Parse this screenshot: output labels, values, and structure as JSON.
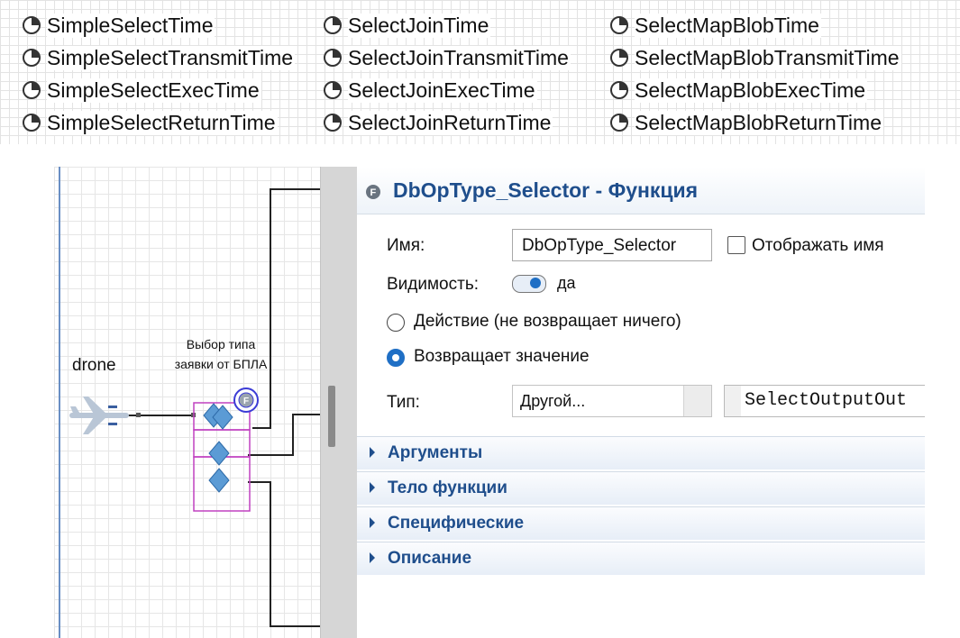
{
  "variables": {
    "col1": [
      "SimpleSelectTime",
      "SimpleSelectTransmitTime",
      "SimpleSelectExecTime",
      "SimpleSelectReturnTime"
    ],
    "col2": [
      "SelectJoinTime",
      "SelectJoinTransmitTime",
      "SelectJoinExecTime",
      "SelectJoinReturnTime"
    ],
    "col3": [
      "SelectMapBlobTime",
      "SelectMapBlobTransmitTime",
      "SelectMapBlobExecTime",
      "SelectMapBlobReturnTime"
    ],
    "icon": "statistics-gauge-icon"
  },
  "canvas": {
    "source_label": "drone",
    "block_label_line1": "Выбор типа",
    "block_label_line2": "заявки от БПЛА",
    "function_icon": "function-icon",
    "source_icon": "airplane-icon"
  },
  "properties": {
    "title": "DbOpType_Selector - Функция",
    "name_label": "Имя:",
    "name_value": "DbOpType_Selector",
    "show_name_label": "Отображать имя",
    "show_name_checked": false,
    "visibility_label": "Видимость:",
    "visibility_value": "да",
    "radio_action_label": "Действие (не возвращает ничего)",
    "radio_returns_label": "Возвращает значение",
    "type_label": "Тип:",
    "type_value": "Другой...",
    "type_code": "SelectOutputOut",
    "sections": [
      "Аргументы",
      "Тело функции",
      "Специфические",
      "Описание"
    ]
  },
  "colors": {
    "accent": "#1f4e8c",
    "radio": "#1f6fc5",
    "block": "#c040c0"
  }
}
